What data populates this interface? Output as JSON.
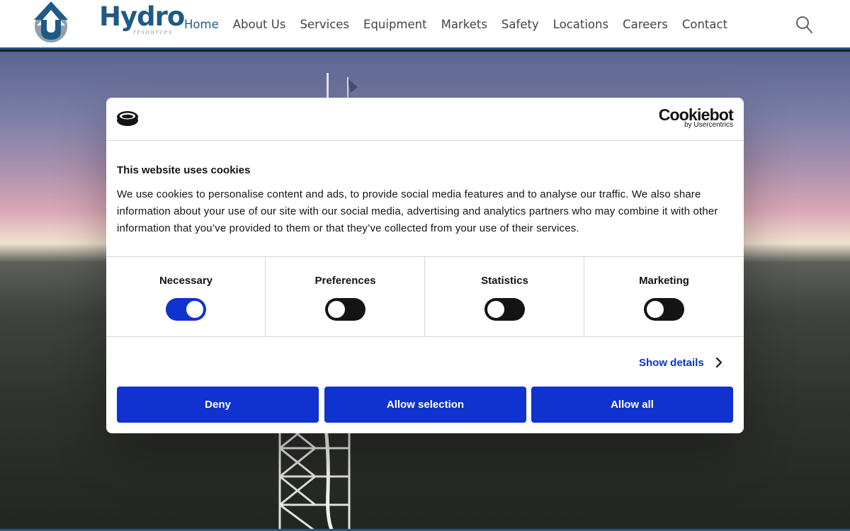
{
  "header": {
    "logo_name": "Hydro",
    "logo_sub": "resources",
    "nav": [
      {
        "label": "Home",
        "active": true
      },
      {
        "label": "About Us"
      },
      {
        "label": "Services"
      },
      {
        "label": "Equipment"
      },
      {
        "label": "Markets"
      },
      {
        "label": "Safety"
      },
      {
        "label": "Locations"
      },
      {
        "label": "Careers"
      },
      {
        "label": "Contact"
      }
    ],
    "search_icon": "search-icon"
  },
  "cookie_dialog": {
    "brand": "Cookiebot",
    "brand_sub": "by Usercentrics",
    "title": "This website uses cookies",
    "body": "We use cookies to personalise content and ads, to provide social media features and to analyse our traffic. We also share information about your use of our site with our social media, advertising and analytics partners who may combine it with other information that you’ve provided to them or that they’ve collected from your use of their services.",
    "categories": [
      {
        "label": "Necessary",
        "enabled": true
      },
      {
        "label": "Preferences",
        "enabled": false
      },
      {
        "label": "Statistics",
        "enabled": false
      },
      {
        "label": "Marketing",
        "enabled": false
      }
    ],
    "show_details": "Show details",
    "buttons": {
      "deny": "Deny",
      "allow_selection": "Allow selection",
      "allow_all": "Allow all"
    }
  },
  "colors": {
    "brand_blue": "#1f5a86",
    "consent_blue": "#1032cf",
    "toggle_off": "#141414"
  }
}
